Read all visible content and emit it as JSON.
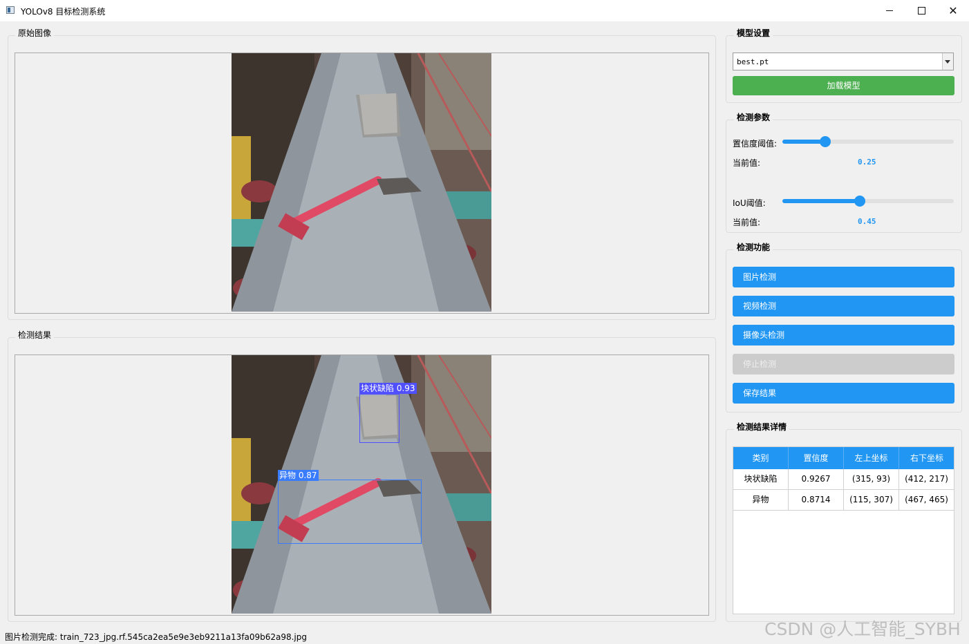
{
  "window": {
    "title": "YOLOv8 目标检测系统"
  },
  "panels": {
    "original": {
      "title": "原始图像"
    },
    "result": {
      "title": "检测结果"
    }
  },
  "model_settings": {
    "title": "模型设置",
    "model_select_value": "best.pt",
    "load_button": "加载模型"
  },
  "detect_params": {
    "title": "检测参数",
    "conf_label": "置信度阈值:",
    "conf_current_label": "当前值:",
    "conf_value": "0.25",
    "conf_fraction": 0.25,
    "iou_label": "IoU阈值:",
    "iou_current_label": "当前值:",
    "iou_value": "0.45",
    "iou_fraction": 0.45
  },
  "detect_functions": {
    "title": "检测功能",
    "image_detect": "图片检测",
    "video_detect": "视频检测",
    "camera_detect": "摄像头检测",
    "stop_detect": "停止检测",
    "save_result": "保存结果"
  },
  "result_details": {
    "title": "检测结果详情",
    "headers": [
      "类别",
      "置信度",
      "左上坐标",
      "右下坐标"
    ],
    "rows": [
      [
        "块状缺陷",
        "0.9267",
        "(315, 93)",
        "(412, 217)"
      ],
      [
        "异物",
        "0.8714",
        "(115, 307)",
        "(467, 465)"
      ]
    ]
  },
  "detections": [
    {
      "label": "块状缺陷 0.93",
      "color": "#5050ff"
    },
    {
      "label": "异物 0.87",
      "color": "#3a7cff"
    }
  ],
  "status": {
    "text": "图片检测完成: train_723_jpg.rf.545ca2ea5e9e3eb9211a13fa09b62a98.jpg"
  },
  "watermark": "CSDN @人工智能_SYBH"
}
